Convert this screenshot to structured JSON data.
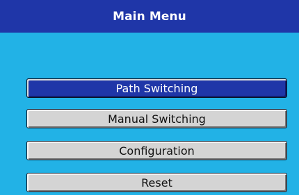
{
  "window": {
    "title": "Main Menu"
  },
  "menu": {
    "items": [
      {
        "label": "Path Switching",
        "selected": true
      },
      {
        "label": "Manual Switching",
        "selected": false
      },
      {
        "label": "Configuration",
        "selected": false
      },
      {
        "label": "Reset",
        "selected": false
      }
    ]
  },
  "colors": {
    "title_bar": "#1F36A8",
    "background": "#22B2E6",
    "button_face": "#D4D4D4",
    "selected_button": "#1F36A8",
    "button_text": "#111111",
    "selected_text": "#FFFFFF"
  }
}
